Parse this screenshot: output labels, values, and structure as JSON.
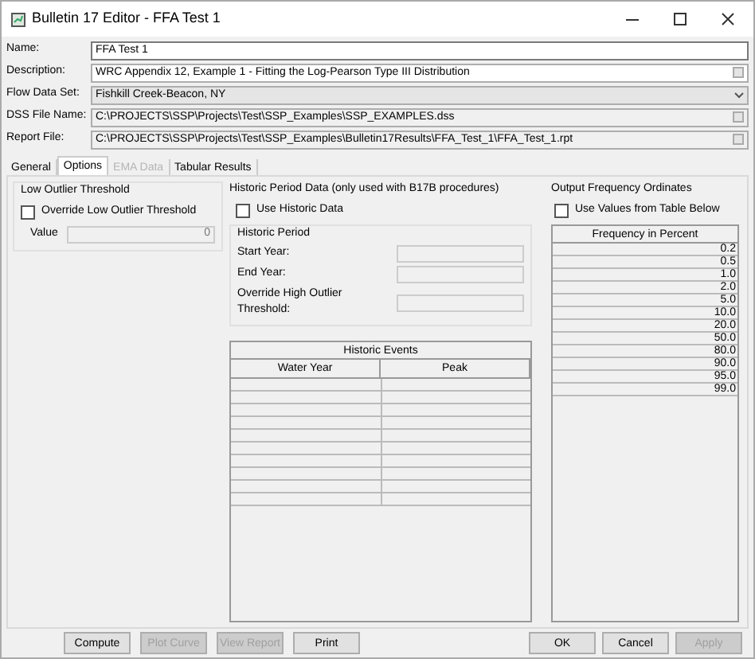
{
  "window": {
    "title": "Bulletin 17 Editor - FFA Test 1"
  },
  "fields": [
    {
      "label": "Name:",
      "value": "FFA Test 1",
      "kind": "text"
    },
    {
      "label": "Description:",
      "value": "WRC Appendix 12, Example 1 - Fitting the Log-Pearson Type III Distribution",
      "kind": "browse"
    },
    {
      "label": "Flow Data Set:",
      "value": "Fishkill Creek-Beacon, NY",
      "kind": "dropdown"
    },
    {
      "label": "DSS File Name:",
      "value": "C:\\PROJECTS\\SSP\\Projects\\Test\\SSP_Examples\\SSP_EXAMPLES.dss",
      "kind": "readonly"
    },
    {
      "label": "Report File:",
      "value": "C:\\PROJECTS\\SSP\\Projects\\Test\\SSP_Examples\\Bulletin17Results\\FFA_Test_1\\FFA_Test_1.rpt",
      "kind": "readonly"
    }
  ],
  "tabs": [
    {
      "label": "General",
      "selected": false,
      "disabled": false
    },
    {
      "label": "Options",
      "selected": true,
      "disabled": false
    },
    {
      "label": "EMA Data",
      "selected": false,
      "disabled": true
    },
    {
      "label": "Tabular Results",
      "selected": false,
      "disabled": false
    }
  ],
  "low_outlier": {
    "title": "Low Outlier Threshold",
    "checkbox": {
      "label": "Override Low Outlier Threshold",
      "checked": false
    },
    "value_label": "Value",
    "value": "0"
  },
  "historic": {
    "title": "Historic Period Data (only used with B17B procedures)",
    "checkbox": {
      "label": "Use Historic Data",
      "checked": false
    },
    "period_title": "Historic Period",
    "period_fields": [
      "Start Year:",
      "End Year:",
      "Override High Outlier Threshold:"
    ],
    "events_table": {
      "title": "Historic Events",
      "columns": [
        "Water Year",
        "Peak"
      ]
    }
  },
  "output": {
    "title": "Output Frequency Ordinates",
    "checkbox": {
      "label": "Use Values from Table Below",
      "checked": false
    },
    "table": {
      "columns": [
        "Frequency in Percent"
      ],
      "rows": [
        "0.2",
        "0.5",
        "1.0",
        "2.0",
        "5.0",
        "10.0",
        "20.0",
        "50.0",
        "80.0",
        "90.0",
        "95.0",
        "99.0"
      ]
    }
  },
  "buttons_left": [
    {
      "label": "Compute",
      "disabled": false
    },
    {
      "label": "Plot Curve",
      "disabled": true
    },
    {
      "label": "View Report",
      "disabled": true
    },
    {
      "label": "Print",
      "disabled": false
    }
  ],
  "buttons_right": [
    {
      "label": "OK",
      "disabled": false
    },
    {
      "label": "Cancel",
      "disabled": false
    },
    {
      "label": "Apply",
      "disabled": true
    }
  ]
}
